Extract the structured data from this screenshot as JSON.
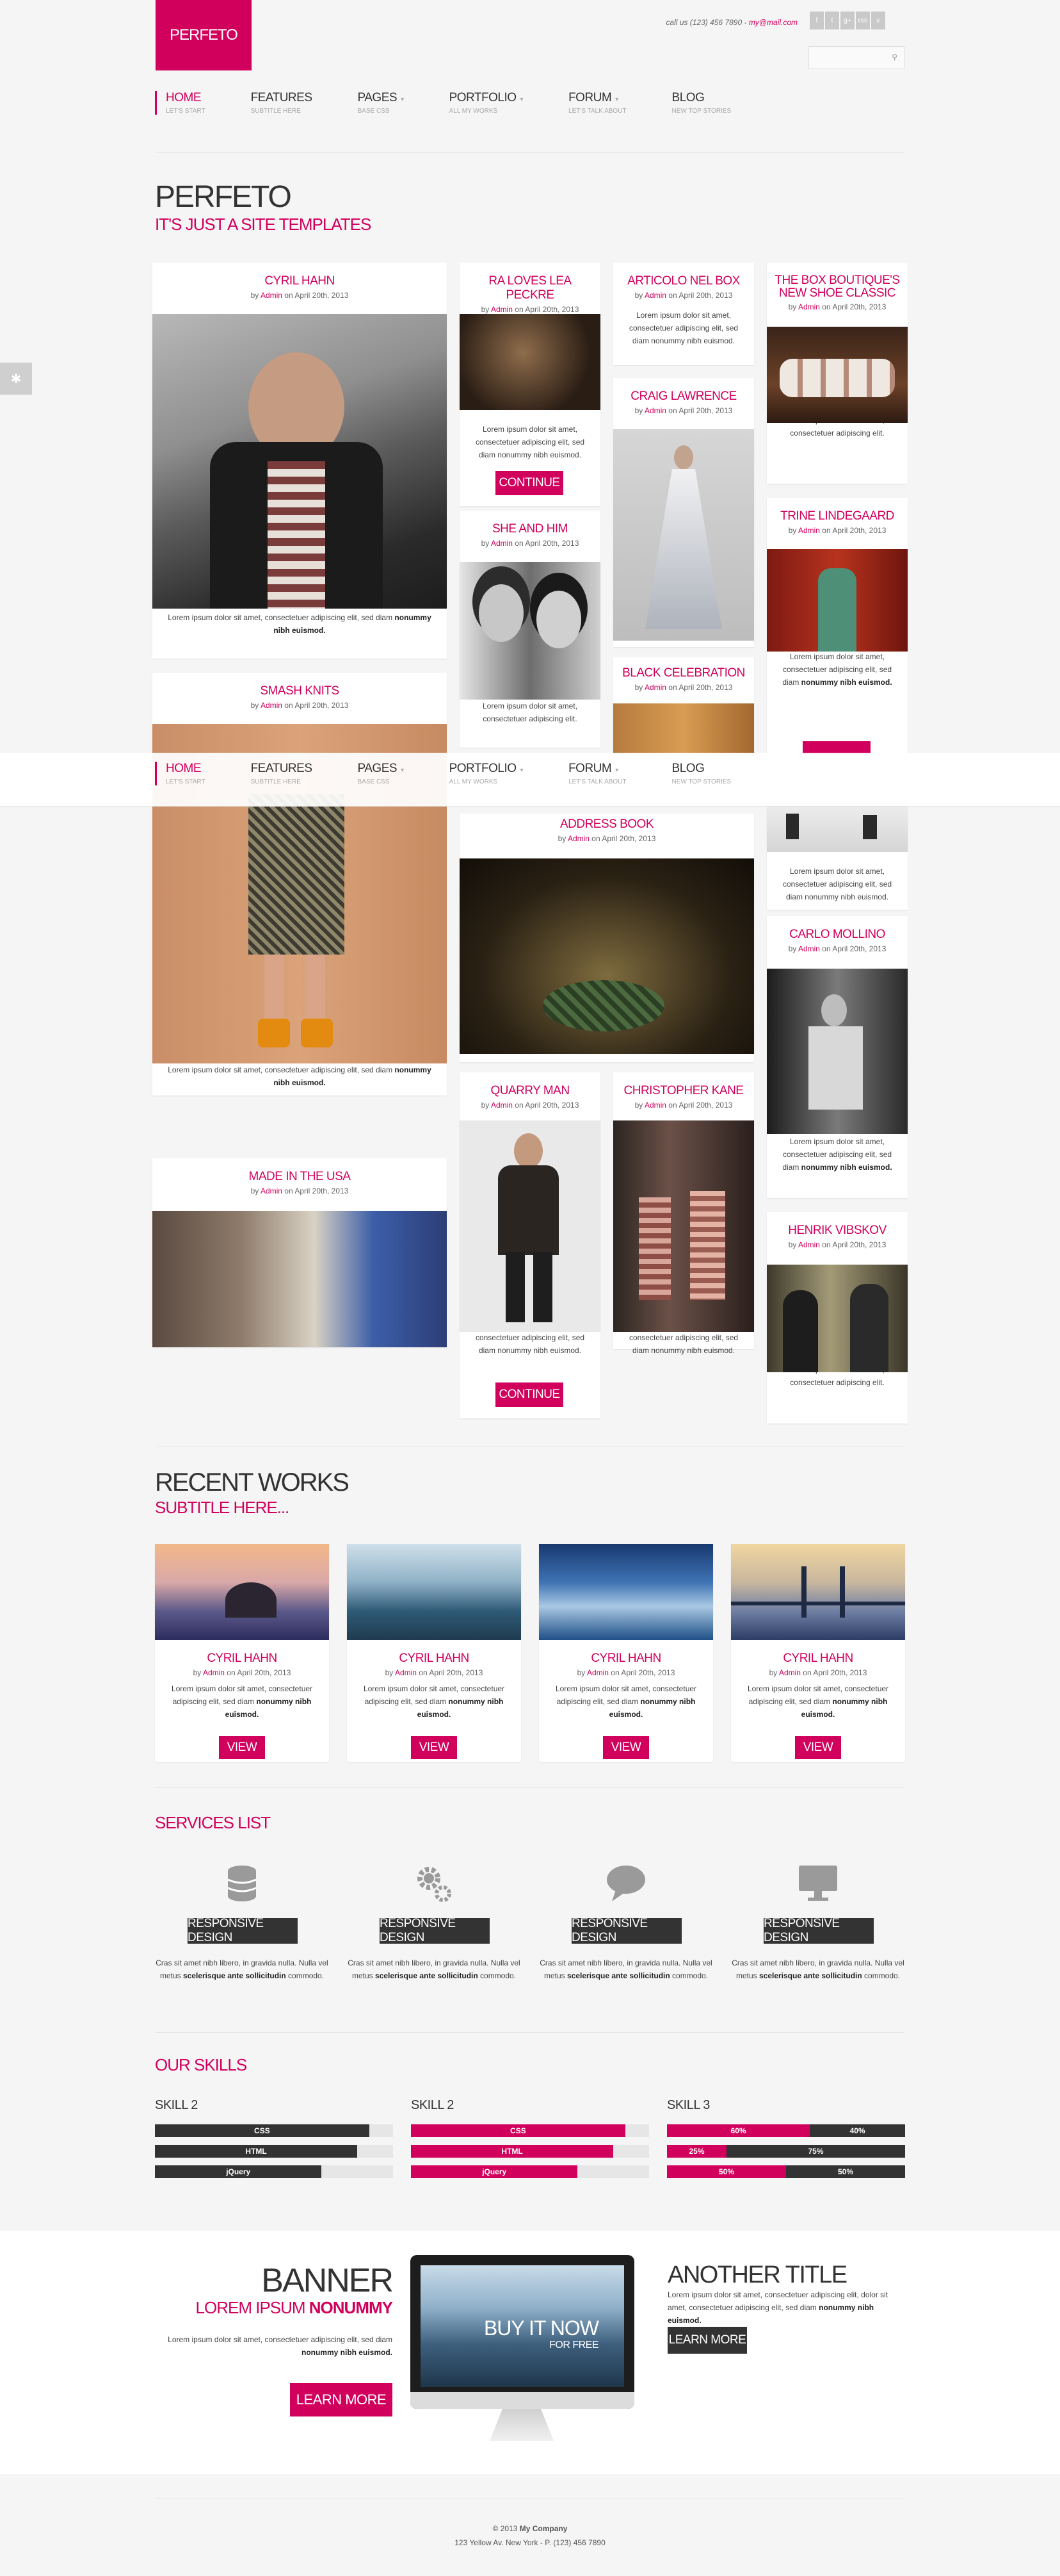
{
  "brand": {
    "logo": "PERFETO",
    "accent": "#d1005d"
  },
  "contact": {
    "phone": "call us (123) 456 7890 - ",
    "email": "my@mail.com"
  },
  "social": [
    "f",
    "t",
    "g+",
    "rss",
    "v"
  ],
  "search": {
    "icon": "search-icon"
  },
  "nav": [
    {
      "label": "HOME",
      "sub": "LET'S START",
      "active": true
    },
    {
      "label": "FEATURES",
      "sub": "SUBTITLE HERE"
    },
    {
      "label": "PAGES",
      "sub": "BASE CSS"
    },
    {
      "label": "PORTFOLIO",
      "sub": "ALL MY WORKS"
    },
    {
      "label": "FORUM",
      "sub": "LET'S TALK ABOUT"
    },
    {
      "label": "BLOG",
      "sub": "NEW TOP STORIES"
    }
  ],
  "hero": {
    "title": "PERFETO",
    "subtitle": "IT'S JUST A SITE TEMPLATES"
  },
  "common": {
    "by": "by ",
    "admin": "Admin",
    "date": " on April 20th, 2013",
    "lorem_short": "Lorem ipsum dolor sit amet, consectetuer adipiscing elit, sed diam nonummy nibh euismod.",
    "continue": "CONTINUE",
    "view": "VIEW"
  },
  "cards": [
    {
      "title": "CYRIL HAHN",
      "text_a": "Lorem ipsum dolor sit amet, consectetuer adipiscing elit, sed diam ",
      "text_b": "nonummy nibh euismod."
    },
    {
      "title": "SMASH KNITS"
    },
    {
      "title": "RA LOVES LEA PECKRE",
      "text": "Lorem ipsum dolor sit amet, consectetuer adipiscing elit, sed diam nonummy nibh euismod."
    },
    {
      "title": "SHE AND HIM",
      "text": "Lorem ipsum dolor sit amet, consectetuer adipiscing elit."
    },
    {
      "title": "ARTICOLO NEL BOX",
      "text": "Lorem ipsum dolor sit amet, consectetuer adipiscing elit, sed diam nonummy nibh euismod."
    },
    {
      "title": "CRAIG LAWRENCE"
    },
    {
      "title": "BLACK CELEBRATION"
    },
    {
      "title": "THE BOX BOUTIQUE'S NEW SHOE CLASSIC",
      "text": "Lorem ipsum dolor sit amet, consectetuer adipiscing elit."
    },
    {
      "title": "TRINE LINDEGAARD",
      "text_a": "Lorem ipsum dolor sit amet, consectetuer adipiscing elit, sed diam ",
      "text_b": "nonummy nibh euismod."
    },
    {
      "title": "ADDRESS BOOK"
    },
    {
      "title": "QUARRY MAN",
      "text": "Lorem ipsum dolor sit amet, consectetuer adipiscing elit, sed diam nonummy nibh euismod."
    },
    {
      "title": "CHRISTOPHER KANE",
      "text": "Lorem ipsum dolor sit amet, consectetuer adipiscing elit, sed diam nonummy nibh euismod."
    },
    {
      "title": "CARLO MOLLINO",
      "text_a": "Lorem ipsum dolor sit amet, consectetuer adipiscing elit, sed diam ",
      "text_b": "nonummy nibh euismod."
    },
    {
      "title": "HENRIK VIBSKOV",
      "text": "Lorem ipsum dolor sit amet, consectetuer adipiscing elit."
    },
    {
      "title": "MADE IN THE USA"
    }
  ],
  "recent": {
    "title": "RECENT WORKS",
    "subtitle": "SUBTITLE HERE...",
    "items": [
      {
        "title": "CYRIL HAHN"
      },
      {
        "title": "CYRIL HAHN"
      },
      {
        "title": "CYRIL HAHN"
      },
      {
        "title": "CYRIL HAHN"
      }
    ],
    "text_a": "Lorem ipsum dolor sit amet, consectetuer adipiscing elit, sed diam ",
    "text_b": "nonummy nibh euismod."
  },
  "services": {
    "title": "SERVICES LIST",
    "items": [
      {
        "icon": "database-icon",
        "label": "RESPONSIVE DESIGN"
      },
      {
        "icon": "gears-icon",
        "label": "RESPONSIVE DESIGN"
      },
      {
        "icon": "speech-bubble-icon",
        "label": "RESPONSIVE DESIGN"
      },
      {
        "icon": "monitor-icon",
        "label": "RESPONSIVE DESIGN"
      }
    ],
    "text_a": "Cras sit amet nibh libero, in gravida nulla. Nulla vel metus ",
    "text_b": "scelerisque ante sollicitudin",
    "text_c": " commodo."
  },
  "skills": {
    "title": "OUR SKILLS",
    "groups": [
      {
        "name": "SKILL 2",
        "bars": [
          {
            "label": "CSS",
            "value": 0.9
          },
          {
            "label": "HTML",
            "value": 0.85
          },
          {
            "label": "jQuery",
            "value": 0.7
          }
        ]
      },
      {
        "name": "SKILL 2",
        "bars": [
          {
            "label": "CSS",
            "value": 0.9
          },
          {
            "label": "HTML",
            "value": 0.85
          },
          {
            "label": "jQuery",
            "value": 0.7
          }
        ]
      },
      {
        "name": "SKILL 3",
        "bars": [
          {
            "label": "60%",
            "rest": "40%",
            "value": 0.6
          },
          {
            "label": "25%",
            "rest": "75%",
            "value": 0.25
          },
          {
            "label": "50%",
            "rest": "50%",
            "value": 0.5
          }
        ]
      }
    ]
  },
  "banner": {
    "title": "BANNER",
    "subtitle_a": "LOREM IPSUM ",
    "subtitle_b": "NONUMMY",
    "text_a": "Lorem ipsum dolor sit amet, consectetuer adipiscing elit, sed diam ",
    "text_b": "nonummy nibh euismod.",
    "button": "LEARN MORE",
    "screen_main": "BUY IT NOW",
    "screen_sub": "FOR FREE",
    "other_title": "ANOTHER TITLE",
    "other_text_a": "Lorem ipsum dolor sit amet, consectetuer adipiscing elit, dolor sit amet, consectetuer adipiscing elit, sed diam ",
    "other_text_b": "nonummy nibh euismod.",
    "other_button": "LEARN MORE"
  },
  "footer": {
    "copy_a": "© 2013 ",
    "copy_b": "My Company",
    "address": "123 Yellow Av. New York - P. (123) 456 7890"
  }
}
